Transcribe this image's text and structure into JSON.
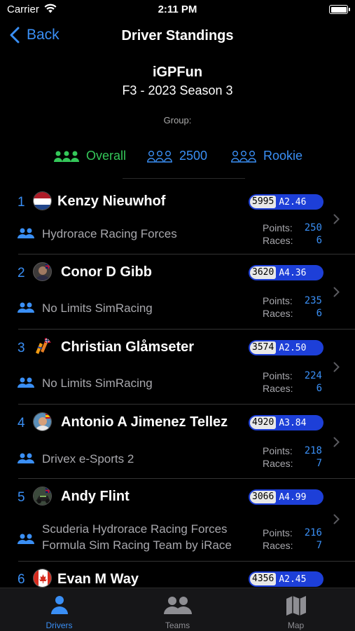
{
  "status": {
    "carrier": "Carrier",
    "time": "2:11 PM"
  },
  "nav": {
    "back_label": "Back",
    "title": "Driver Standings"
  },
  "header": {
    "league": "iGPFun",
    "season": "F3 - 2023 Season 3",
    "group_label": "Group:"
  },
  "filters": [
    {
      "label": "Overall",
      "active": true
    },
    {
      "label": "2500",
      "active": false
    },
    {
      "label": "Rookie",
      "active": false
    }
  ],
  "labels": {
    "points": "Points:",
    "races": "Races:"
  },
  "drivers": [
    {
      "pos": "1",
      "name": "Kenzy Nieuwhof",
      "irating": "5995",
      "sr": "A2.46",
      "team": "Hydrorace Racing Forces",
      "points": "250",
      "races": "6",
      "avatar": "flag-netherlands"
    },
    {
      "pos": "2",
      "name": "Conor D Gibb",
      "irating": "3620",
      "sr": "A4.36",
      "team": "No Limits SimRacing",
      "points": "235",
      "races": "6",
      "avatar": "photo-with-uk-flag"
    },
    {
      "pos": "3",
      "name": "Christian Glåmseter",
      "irating": "3574",
      "sr": "A2.50",
      "team": "No Limits SimRacing",
      "points": "224",
      "races": "6",
      "avatar": "helmet-with-norway-flag"
    },
    {
      "pos": "4",
      "name": "Antonio A Jimenez Tellez",
      "irating": "4920",
      "sr": "A3.84",
      "team": "Drivex e-Sports 2",
      "points": "218",
      "races": "7",
      "avatar": "photo-with-spain-flag"
    },
    {
      "pos": "5",
      "name": "Andy Flint",
      "irating": "3066",
      "sr": "A4.99",
      "team_lines": [
        "Scuderia Hydrorace Racing Forces",
        "Formula Sim Racing Team by iRace"
      ],
      "points": "216",
      "races": "7",
      "avatar": "car-photo-with-flag"
    },
    {
      "pos": "6",
      "name": "Evan M Way",
      "irating": "4356",
      "sr": "A2.45",
      "avatar": "flag-canada"
    }
  ],
  "tabs": [
    {
      "label": "Drivers",
      "icon": "person-icon",
      "active": true
    },
    {
      "label": "Teams",
      "icon": "two-persons-icon",
      "active": false
    },
    {
      "label": "Map",
      "icon": "map-icon",
      "active": false
    }
  ],
  "colors": {
    "accent": "#3a8ff5",
    "active_filter": "#34c759",
    "badge": "#1d3fd8",
    "secondary_text": "#a8a8ad"
  }
}
